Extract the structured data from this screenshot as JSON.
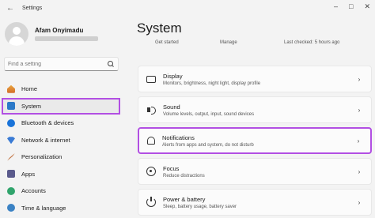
{
  "titlebar": {
    "title": "Settings"
  },
  "profile": {
    "name": "Afam Onyimadu"
  },
  "search": {
    "placeholder": "Find a setting"
  },
  "nav": [
    {
      "label": "Home",
      "icon": "home-icon"
    },
    {
      "label": "System",
      "icon": "system-icon",
      "selected": true
    },
    {
      "label": "Bluetooth & devices",
      "icon": "bluetooth-icon"
    },
    {
      "label": "Network & internet",
      "icon": "network-icon"
    },
    {
      "label": "Personalization",
      "icon": "personalization-icon"
    },
    {
      "label": "Apps",
      "icon": "apps-icon"
    },
    {
      "label": "Accounts",
      "icon": "accounts-icon"
    },
    {
      "label": "Time & language",
      "icon": "time-icon"
    }
  ],
  "main": {
    "title": "System",
    "quick_links": [
      "Get started",
      "Manage",
      "Last checked: 5 hours ago"
    ],
    "cards": [
      {
        "title": "Display",
        "subtitle": "Monitors, brightness, night light, display profile",
        "icon": "display-icon"
      },
      {
        "title": "Sound",
        "subtitle": "Volume levels, output, input, sound devices",
        "icon": "sound-icon"
      },
      {
        "title": "Notifications",
        "subtitle": "Alerts from apps and system, do not disturb",
        "icon": "bell-icon",
        "highlighted": true
      },
      {
        "title": "Focus",
        "subtitle": "Reduce distractions",
        "icon": "focus-icon"
      },
      {
        "title": "Power & battery",
        "subtitle": "Sleep, battery usage, battery saver",
        "icon": "power-icon"
      }
    ]
  },
  "colors": {
    "highlight": "#b24fe3",
    "accent": "#2b79c8"
  }
}
